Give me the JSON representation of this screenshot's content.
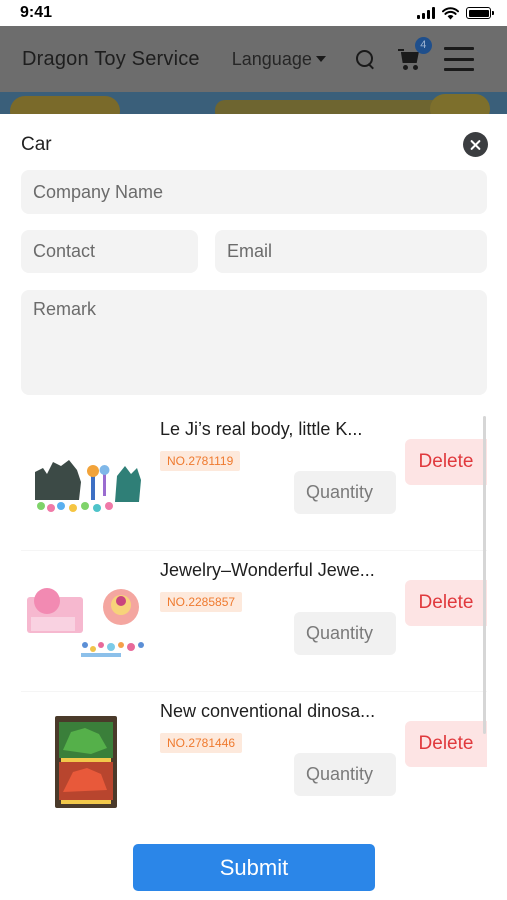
{
  "status_bar": {
    "time": "9:41"
  },
  "header": {
    "brand": "Dragon Toy Service",
    "language_label": "Language",
    "cart_count": "4"
  },
  "sheet": {
    "title": "Car",
    "form": {
      "company_placeholder": "Company Name",
      "contact_placeholder": "Contact",
      "email_placeholder": "Email",
      "remark_placeholder": "Remark"
    },
    "items": [
      {
        "name": "Le Ji’s real body, little K...",
        "number": "NO.2781119",
        "delete_label": "Delete",
        "quantity_placeholder": "Quantity",
        "image_icon": "sand-castle-toy-image"
      },
      {
        "name": "Jewelry–Wonderful Jewe...",
        "number": "NO.2285857",
        "delete_label": "Delete",
        "quantity_placeholder": "Quantity",
        "image_icon": "jewelry-toy-set-image"
      },
      {
        "name": "New conventional dinosa...",
        "number": "NO.2781446",
        "delete_label": "Delete",
        "quantity_placeholder": "Quantity",
        "image_icon": "dinosaur-toy-box-image"
      }
    ],
    "submit_label": "Submit"
  },
  "colors": {
    "header_dimmed": "#6d6d6d",
    "submit_blue": "#2b86e8",
    "delete_red": "#e0393d",
    "delete_bg": "#fde4e4",
    "number_orange": "#ef7a2f",
    "number_bg": "#fde9dc",
    "field_bg": "#f3f3f3"
  }
}
